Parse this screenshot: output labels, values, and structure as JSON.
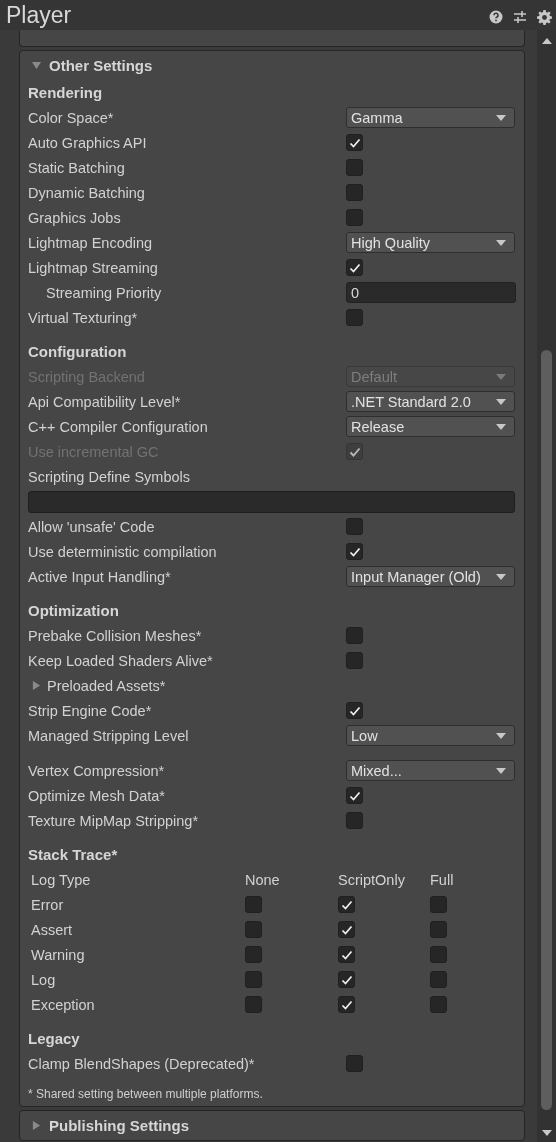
{
  "window": {
    "title": "Player"
  },
  "panels": [
    {
      "title": "Other Settings",
      "expanded": true,
      "sections": [
        {
          "title": "Rendering",
          "kind": "settings",
          "items": [
            {
              "kind": "dropdown",
              "label": "Color Space*",
              "value": "Gamma",
              "disabled": false
            },
            {
              "kind": "checkbox",
              "label": "Auto Graphics API",
              "checked": true,
              "disabled": false
            },
            {
              "kind": "checkbox",
              "label": "Static Batching",
              "checked": false,
              "disabled": false
            },
            {
              "kind": "checkbox",
              "label": "Dynamic Batching",
              "checked": false,
              "disabled": false
            },
            {
              "kind": "checkbox",
              "label": "Graphics Jobs",
              "checked": false,
              "disabled": false
            },
            {
              "kind": "dropdown",
              "label": "Lightmap Encoding",
              "value": "High Quality",
              "disabled": false
            },
            {
              "kind": "checkbox",
              "label": "Lightmap Streaming",
              "checked": true,
              "disabled": false,
              "children": [
                {
                  "kind": "text",
                  "label": "Streaming Priority",
                  "value": "0",
                  "disabled": false
                }
              ]
            },
            {
              "kind": "checkbox",
              "label": "Virtual Texturing*",
              "checked": false,
              "disabled": false
            }
          ]
        },
        {
          "title": "Configuration",
          "kind": "settings",
          "items": [
            {
              "kind": "dropdown",
              "label": "Scripting Backend",
              "value": "Default",
              "disabled": true
            },
            {
              "kind": "dropdown",
              "label": "Api Compatibility Level*",
              "value": ".NET Standard 2.0",
              "disabled": false
            },
            {
              "kind": "dropdown",
              "label": "C++ Compiler Configuration",
              "value": "Release",
              "disabled": false
            },
            {
              "kind": "checkbox",
              "label": "Use incremental GC",
              "checked": true,
              "disabled": true
            },
            {
              "kind": "wide_text",
              "label": "Scripting Define Symbols",
              "disabled": false
            },
            {
              "kind": "checkbox",
              "label": "Allow 'unsafe' Code",
              "checked": false,
              "disabled": false
            },
            {
              "kind": "checkbox",
              "label": "Use deterministic compilation",
              "checked": true,
              "disabled": false
            },
            {
              "kind": "dropdown",
              "label": "Active Input Handling*",
              "value": "Input Manager (Old)",
              "disabled": false
            }
          ]
        },
        {
          "title": "Optimization",
          "kind": "settings",
          "items": [
            {
              "kind": "checkbox",
              "label": "Prebake Collision Meshes*",
              "checked": false,
              "disabled": false
            },
            {
              "kind": "checkbox",
              "label": "Keep Loaded Shaders Alive*",
              "checked": false,
              "disabled": false
            },
            {
              "kind": "foldout",
              "label": "Preloaded Assets*",
              "expanded": false,
              "disabled": false
            },
            {
              "kind": "checkbox",
              "label": "Strip Engine Code*",
              "checked": true,
              "disabled": false
            },
            {
              "kind": "dropdown",
              "label": "Managed Stripping Level",
              "value": "Low",
              "disabled": false
            },
            {
              "kind": "dropdown",
              "label": "Vertex Compression*",
              "value": "Mixed...",
              "disabled": false,
              "gap_before": true
            },
            {
              "kind": "checkbox",
              "label": "Optimize Mesh Data*",
              "checked": true,
              "disabled": false
            },
            {
              "kind": "checkbox",
              "label": "Texture MipMap Stripping*",
              "checked": false,
              "disabled": false
            }
          ]
        },
        {
          "title": "Stack Trace*",
          "kind": "table",
          "columns": [
            "Log Type",
            "None",
            "ScriptOnly",
            "Full"
          ],
          "rows": [
            {
              "label": "Error",
              "options": [
                {
                  "checked": false
                },
                {
                  "checked": true
                },
                {
                  "checked": false
                }
              ]
            },
            {
              "label": "Assert",
              "options": [
                {
                  "checked": false
                },
                {
                  "checked": true
                },
                {
                  "checked": false
                }
              ]
            },
            {
              "label": "Warning",
              "options": [
                {
                  "checked": false
                },
                {
                  "checked": true
                },
                {
                  "checked": false
                }
              ]
            },
            {
              "label": "Log",
              "options": [
                {
                  "checked": false
                },
                {
                  "checked": true
                },
                {
                  "checked": false
                }
              ]
            },
            {
              "label": "Exception",
              "options": [
                {
                  "checked": false
                },
                {
                  "checked": true
                },
                {
                  "checked": false
                }
              ]
            }
          ]
        },
        {
          "title": "Legacy",
          "kind": "settings",
          "items": [
            {
              "kind": "checkbox",
              "label": "Clamp BlendShapes (Deprecated)*",
              "checked": false,
              "disabled": false
            }
          ]
        }
      ],
      "footnote": "* Shared setting between multiple platforms."
    },
    {
      "title": "Publishing Settings",
      "expanded": false
    }
  ]
}
